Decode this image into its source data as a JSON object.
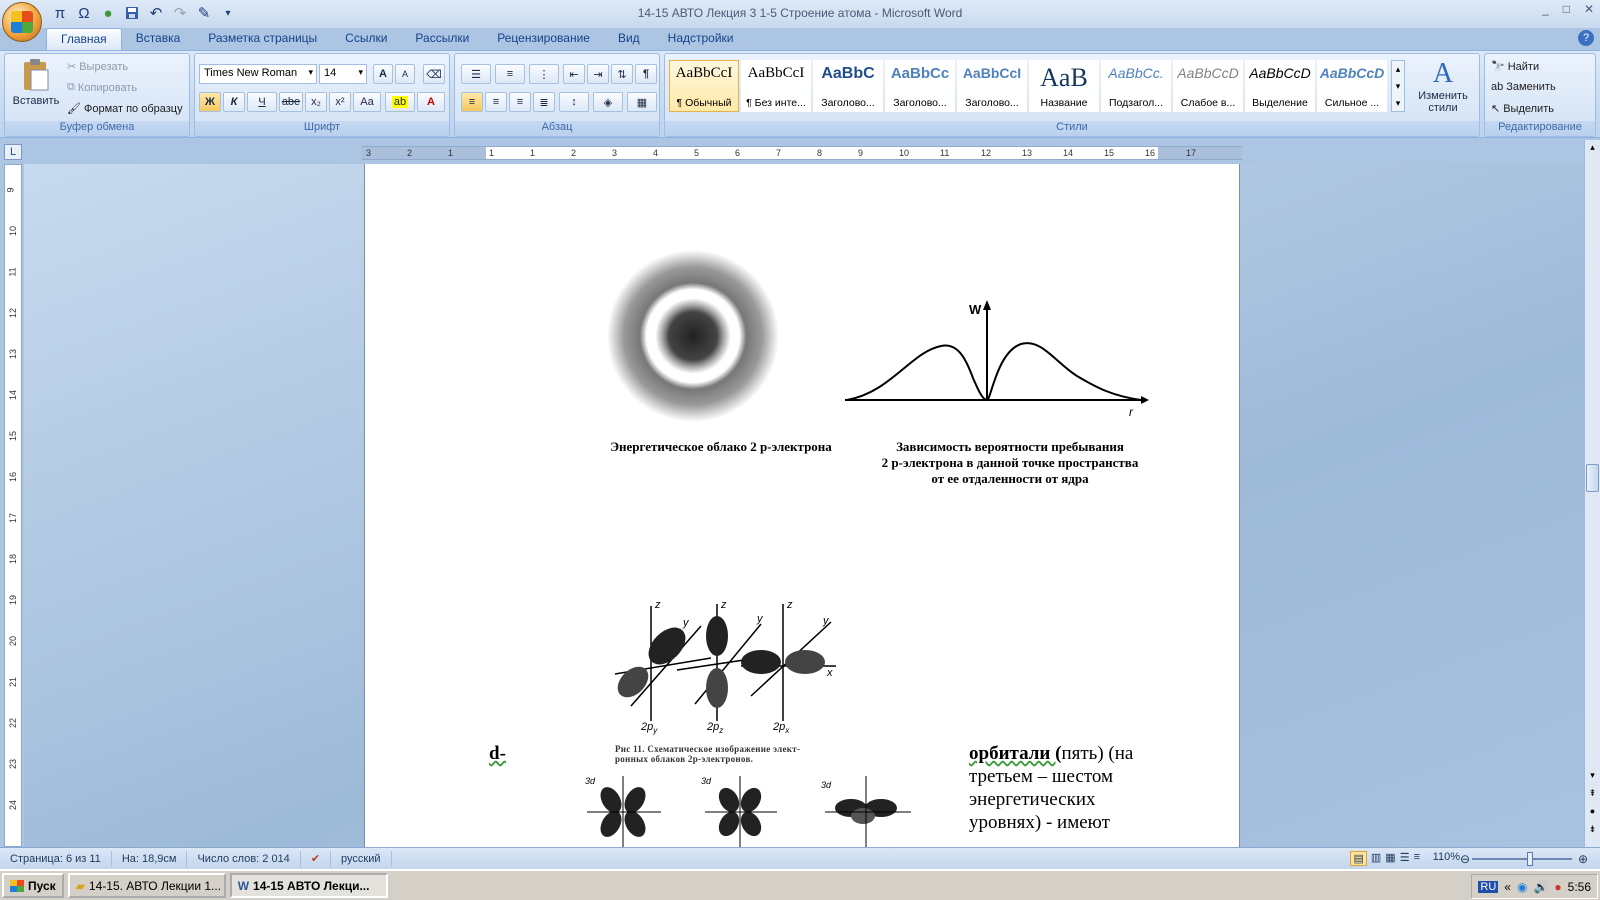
{
  "window": {
    "title": "14-15  АВТО Лекция 3  1-5  Строение  атома - Microsoft Word",
    "controls": [
      "_",
      "□",
      "✕"
    ]
  },
  "qat": {
    "items": [
      "π",
      "Ω",
      "●",
      "💾",
      "↶",
      "↷",
      "✎",
      "▾"
    ]
  },
  "tabs": [
    "Главная",
    "Вставка",
    "Разметка страницы",
    "Ссылки",
    "Рассылки",
    "Рецензирование",
    "Вид",
    "Надстройки"
  ],
  "clipboard": {
    "paste": "Вставить",
    "cut": "Вырезать",
    "copy": "Копировать",
    "format_painter": "Формат по образцу",
    "label": "Буфер обмена"
  },
  "font": {
    "name": "Times New Roman",
    "size": "14",
    "label": "Шрифт",
    "bold": "Ж",
    "italic": "К",
    "underline": "Ч",
    "strike": "abe",
    "subscript": "x₂",
    "superscript": "x²",
    "case": "Aa",
    "grow": "A",
    "shrink": "A"
  },
  "paragraph": {
    "label": "Абзац",
    "pilcrow": "¶"
  },
  "styles": {
    "label": "Стили",
    "items": [
      {
        "sample": "AaBbCcI",
        "name": "¶ Обычный"
      },
      {
        "sample": "AaBbCcI",
        "name": "¶ Без инте..."
      },
      {
        "sample": "AaBbC",
        "name": "Заголово..."
      },
      {
        "sample": "AaBbCc",
        "name": "Заголово..."
      },
      {
        "sample": "AaBbCcI",
        "name": "Заголово..."
      },
      {
        "sample": "AaB",
        "name": "Название"
      },
      {
        "sample": "AaBbCc.",
        "name": "Подзагол..."
      },
      {
        "sample": "AaBbCcD",
        "name": "Слабое в..."
      },
      {
        "sample": "AaBbCcD",
        "name": "Выделение"
      },
      {
        "sample": "AaBbCcD",
        "name": "Сильное ..."
      }
    ],
    "change": "Изменить стили"
  },
  "editing": {
    "label": "Редактирование",
    "find": "Найти",
    "replace": "Заменить",
    "select": "Выделить"
  },
  "ruler": {
    "top_numbers": [
      "3",
      "2",
      "1",
      "1",
      "1",
      "2",
      "3",
      "4",
      "5",
      "6",
      "7",
      "8",
      "9",
      "10",
      "11",
      "12",
      "13",
      "14",
      "15",
      "16",
      "17"
    ],
    "left_numbers": [
      "9",
      "10",
      "11",
      "12",
      "13",
      "14",
      "15",
      "16",
      "17",
      "18",
      "19",
      "20",
      "21",
      "22",
      "23",
      "24"
    ]
  },
  "document": {
    "caption_cloud": "Энергетическое облако 2 р-электрона",
    "caption_graph": [
      "Зависимость вероятности пребывания",
      "2 р-электрона в данной точке пространства",
      "от ее отдаленности от ядра"
    ],
    "graph_w": "W",
    "graph_r": "r",
    "p_labels": [
      "2p",
      "2p",
      "2p"
    ],
    "p_subs": [
      "y",
      "z",
      "x"
    ],
    "fig_caption": [
      "Рис  11.  Схематическое  изображение  элект-",
      "ронных облаков 2р-электронов."
    ],
    "d_label": "d-",
    "body_bold": "орбитали (",
    "body_rest": "пять) (на",
    "body_lines": [
      "третьем – шестом",
      "энергетических",
      "уровнях)  -  имеют"
    ],
    "d_orb_labels": [
      "3d",
      "3d",
      "3d"
    ]
  },
  "status": {
    "page": "Страница: 6 из 11",
    "position": "На: 18,9см",
    "words": "Число слов: 2 014",
    "language": "русский",
    "zoom": "110%"
  },
  "taskbar": {
    "start": "Пуск",
    "tasks": [
      "14-15.  АВТО  Лекции  1...",
      "14-15   АВТО  Лекци..."
    ],
    "lang": "RU",
    "time": "5:56"
  }
}
